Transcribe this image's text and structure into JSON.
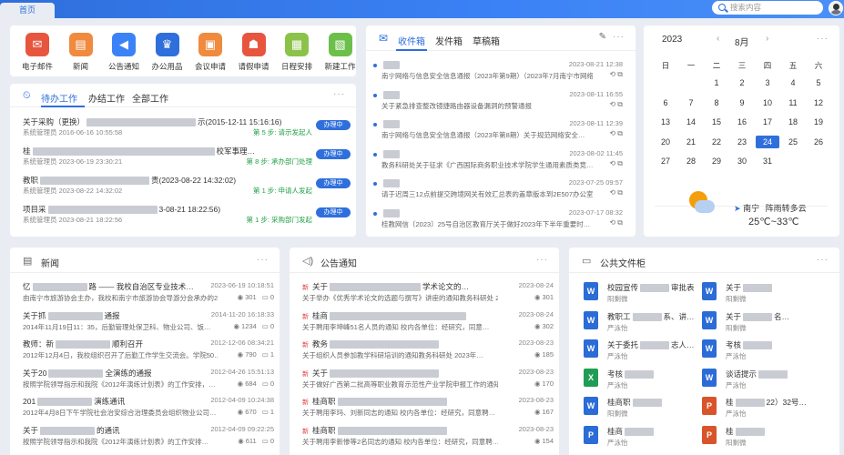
{
  "topbar": {
    "home_tab": "首页",
    "search_placeholder": "搜索内容"
  },
  "apps": [
    {
      "label": "电子邮件",
      "icon": "mail-icon",
      "color": "#e8553e",
      "glyph": "✉"
    },
    {
      "label": "新闻",
      "icon": "news-icon",
      "color": "#f08a3e",
      "glyph": "▤"
    },
    {
      "label": "公告通知",
      "icon": "speaker-icon",
      "color": "#3b82f6",
      "glyph": "◀"
    },
    {
      "label": "办公用品",
      "icon": "supplies-icon",
      "color": "#2f6fdc",
      "glyph": "♛"
    },
    {
      "label": "会议申请",
      "icon": "meeting-icon",
      "color": "#f08a3e",
      "glyph": "▣"
    },
    {
      "label": "请假申请",
      "icon": "leave-icon",
      "color": "#e8553e",
      "glyph": "☗"
    },
    {
      "label": "日程安排",
      "icon": "schedule-icon",
      "color": "#8bc34a",
      "glyph": "▦"
    },
    {
      "label": "新建工作",
      "icon": "new-work-icon",
      "color": "#6cbf4a",
      "glyph": "▧"
    }
  ],
  "tasks": {
    "tabs": [
      "待办工作",
      "办结工作",
      "全部工作"
    ],
    "items": [
      {
        "title": "关于采购（更换）",
        "title_tail": "示(2015-12-11 15:16:16)",
        "meta": "系统管理员  2016-06-16 10:55:58",
        "step": "第 5 步: 请示发起人",
        "action": "办理中"
      },
      {
        "title": "桂",
        "title_tail": "校军事理…",
        "meta": "系统管理员  2023-06-19 23:30:21",
        "step": "第 8 步: 承办部门处理",
        "action": "办理中"
      },
      {
        "title": "教职",
        "title_tail": "责(2023-08-22 14:32:02)",
        "meta": "系统管理员  2023-08-22 14:32:02",
        "step": "第 1 步: 申请人发起",
        "action": "办理中"
      },
      {
        "title": "项目采",
        "title_tail": "3-08-21 18:22:56)",
        "meta": "系统管理员  2023-08-21 18:22:56",
        "step": "第 1 步: 采购部门发起",
        "action": "办理中"
      }
    ]
  },
  "mail": {
    "tabs": [
      "收件箱",
      "发件箱",
      "草稿箱"
    ],
    "items": [
      {
        "time": "2023-08-21 12:38",
        "subject": "南宁网络与信息安全信息通报（2023年第9期）（2023年7月南宁市网络…"
      },
      {
        "time": "2023-08-11 16:55",
        "subject": "关于紧急排查整改镜捷路由器设备漏洞的预警通报"
      },
      {
        "time": "2023-08-11 12:39",
        "subject": "南宁网络与信息安全信息通报（2023年第8期）关于规范网络安全…"
      },
      {
        "time": "2023-08-02 11:45",
        "subject": "教务科研处关于征求《广西国际商务职业技术学院学生通用素质类竞…"
      },
      {
        "time": "2023-07-25 09:57",
        "subject": "请于迟周三12点前提交跨境网关有效汇总表的盖章版本到2E507办公室"
      },
      {
        "time": "2023-07-17 08:32",
        "subject": "桂教网信〔2023〕25号自治区教育厅关于做好2023年下半年重要时…"
      }
    ]
  },
  "calendar": {
    "year": "2023",
    "month": "8月",
    "weekdays": [
      "日",
      "一",
      "二",
      "三",
      "四",
      "五",
      "六"
    ],
    "days": [
      "",
      "",
      "1",
      "2",
      "3",
      "4",
      "5",
      "6",
      "7",
      "8",
      "9",
      "10",
      "11",
      "12",
      "13",
      "14",
      "15",
      "16",
      "17",
      "18",
      "19",
      "20",
      "21",
      "22",
      "23",
      "24",
      "25",
      "26",
      "27",
      "28",
      "29",
      "30",
      "31",
      "",
      ""
    ],
    "today": "24",
    "weather": {
      "city": "南宁",
      "desc": "阵雨转多云",
      "temp": "25℃~33℃"
    }
  },
  "news": {
    "title": "新闻",
    "items": [
      {
        "title": "忆",
        "tail": "路 —— 我校自治区专业技术…",
        "time": "2023-06-19 10:18:51",
        "sub": "由南宁市旅游协会主办，我校和南宁市旅游协会导游分会承办的2…",
        "views": "301",
        "comments": "0"
      },
      {
        "title": "关于抓",
        "tail": "通报",
        "time": "2014-11-20 16:18:33",
        "sub": "2014年11月19日11：35，后勤管理处保卫科、物业公司、饭…",
        "views": "1234",
        "comments": "0"
      },
      {
        "title": "教师：新",
        "tail": "顺利召开",
        "time": "2012-12-06 08:34:21",
        "sub": "2012年12月4日，我校组织召开了后勤工作学生交流会。学院50…",
        "views": "790",
        "comments": "1"
      },
      {
        "title": "关于20",
        "tail": "全演练的通报",
        "time": "2012-04-26 15:51:13",
        "sub": "按照学院领导指示和我院《2012年演练计划表》的工作安排，…",
        "views": "684",
        "comments": "0"
      },
      {
        "title": "201",
        "tail": "演练通讯",
        "time": "2012-04-09 10:24:38",
        "sub": "2012年4月8日下午学院社会治安综合治理委员会组织物业公司…",
        "views": "670",
        "comments": "1"
      },
      {
        "title": "关于",
        "tail": "的通讯",
        "time": "2012-04-09 09:22:25",
        "sub": "按照学院领导指示和我院《2012年演练计划表》的工作安排…",
        "views": "611",
        "comments": "0"
      }
    ]
  },
  "notice": {
    "title": "公告通知",
    "tag": "新",
    "items": [
      {
        "title": "关于",
        "tail": "学术论文的…",
        "time": "2023-08-24",
        "sub": "关于举办《优秀学术论文的选题与撰写》讲座的通知教务科研处 2023…",
        "views": "301",
        "comments": "0"
      },
      {
        "title": "桂商",
        "tail": "",
        "time": "2023-08-24",
        "sub": "关于聘用李坤峰51名人员的通知 校内各单位：经研究，同意…",
        "views": "302",
        "comments": "0"
      },
      {
        "title": "教务",
        "tail": "",
        "time": "2023-08-23",
        "sub": "关于组织人员参加教学科研培训的通知教务科研处 2023年…",
        "views": "185",
        "comments": "0"
      },
      {
        "title": "关于",
        "tail": "",
        "time": "2023-08-23",
        "sub": "关于做好广西第二批高等职业教育示范性产业学院申报工作的通知教…",
        "views": "170",
        "comments": "0"
      },
      {
        "title": "桂商职",
        "tail": "",
        "time": "2023-08-23",
        "sub": "关于聘用李玛、刘新同志的通知 校内各单位：经研究，同意聘…",
        "views": "167",
        "comments": "0"
      },
      {
        "title": "桂商职",
        "tail": "",
        "time": "2023-08-23",
        "sub": "关于聘用李新惨等2名同志的通知 校内各单位：经研究，同意聘…",
        "views": "154",
        "comments": "0"
      }
    ]
  },
  "files": {
    "title": "公共文件柜",
    "left": [
      {
        "name": "校园宣传",
        "tail": "审批表",
        "author": "阳剩微",
        "type": "W",
        "color": "#2b6cd6"
      },
      {
        "name": "教职工",
        "tail": "系、讲…",
        "author": "严泳怡",
        "type": "W",
        "color": "#2b6cd6"
      },
      {
        "name": "关于委托",
        "tail": "志人…",
        "author": "严泳怡",
        "type": "W",
        "color": "#2b6cd6"
      },
      {
        "name": "考核",
        "tail": "",
        "author": "严泳怡",
        "type": "X",
        "color": "#1f9d55"
      },
      {
        "name": "桂商职",
        "tail": "",
        "author": "阳剩微",
        "type": "W",
        "color": "#2b6cd6"
      },
      {
        "name": "桂商",
        "tail": "",
        "author": "严泳怡",
        "type": "P",
        "color": "#2b6cd6"
      }
    ],
    "right": [
      {
        "name": "关于",
        "tail": "",
        "author": "阳剩微",
        "type": "W",
        "color": "#2b6cd6"
      },
      {
        "name": "关于",
        "tail": "名…",
        "author": "阳剩微",
        "type": "W",
        "color": "#2b6cd6"
      },
      {
        "name": "考核",
        "tail": "",
        "author": "严泳怡",
        "type": "W",
        "color": "#2b6cd6"
      },
      {
        "name": "谈话提示",
        "tail": "",
        "author": "严泳怡",
        "type": "W",
        "color": "#2b6cd6"
      },
      {
        "name": "桂",
        "tail": "22）32号…",
        "author": "严泳怡",
        "type": "P",
        "color": "#d9542b"
      },
      {
        "name": "桂",
        "tail": "",
        "author": "阳剩微",
        "type": "P",
        "color": "#d9542b"
      }
    ]
  }
}
